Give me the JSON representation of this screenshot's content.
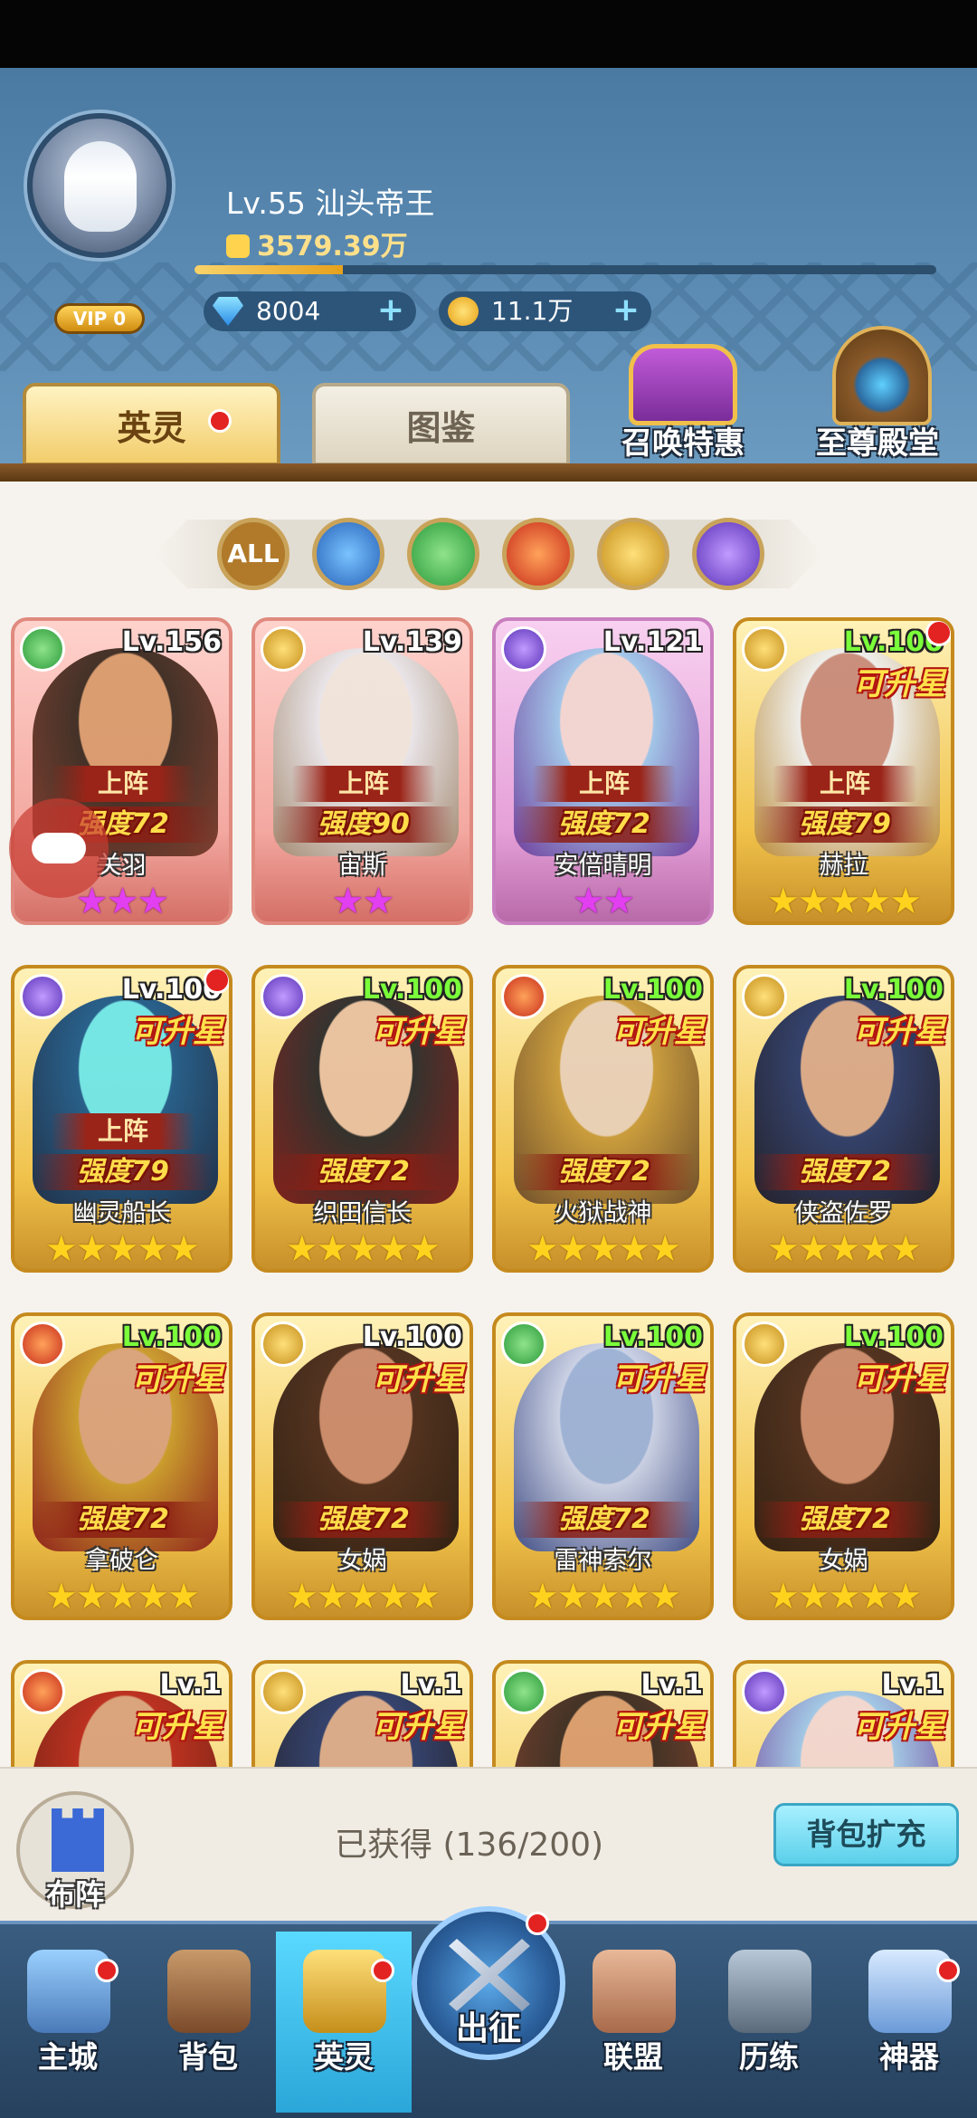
{
  "player": {
    "level_name": "Lv.55   汕头帝王",
    "power": "3579.39万",
    "vip": "VIP 0",
    "exp_progress": 0.2
  },
  "currencies": {
    "gems": "8004",
    "gold": "11.1万"
  },
  "tabs": {
    "heroes": "英灵",
    "gallery": "图鉴"
  },
  "shortcuts": {
    "summon_deal": "召唤特惠",
    "supreme_hall": "至尊殿堂"
  },
  "filters": {
    "all": "ALL"
  },
  "heroes": [
    {
      "level": "Lv.156",
      "level_green": false,
      "upgradable": "",
      "deployed": "上阵",
      "strength": "强度72",
      "name": "关羽",
      "stars": "★★★",
      "star_type": "pink",
      "element": "nature",
      "frame": "red",
      "skin": "#d89b6c",
      "tone": "#3a2a20",
      "tone2": "#7a3a2a"
    },
    {
      "level": "Lv.139",
      "level_green": false,
      "upgradable": "",
      "deployed": "上阵",
      "strength": "强度90",
      "name": "宙斯",
      "stars": "★★",
      "star_type": "pink",
      "element": "light",
      "frame": "red",
      "skin": "#f0e6dc",
      "tone": "#e8e6ea",
      "tone2": "#a08a70"
    },
    {
      "level": "Lv.121",
      "level_green": false,
      "upgradable": "",
      "deployed": "上阵",
      "strength": "强度72",
      "name": "安倍晴明",
      "stars": "★★",
      "star_type": "pink",
      "element": "dark",
      "frame": "purple",
      "skin": "#f2d6d0",
      "tone": "#9ec6e8",
      "tone2": "#6a3a9a"
    },
    {
      "level": "Lv.100",
      "level_green": true,
      "upgradable": "可升星",
      "deployed": "上阵",
      "strength": "强度79",
      "name": "赫拉",
      "stars": "★★★★★",
      "star_type": "gold",
      "element": "light",
      "frame": "gold",
      "skin": "#c88a7a",
      "tone": "#eeeeee",
      "tone2": "#b88a3a",
      "dot": true
    },
    {
      "level": "Lv.100",
      "level_green": false,
      "upgradable": "可升星",
      "deployed": "上阵",
      "strength": "强度79",
      "name": "幽灵船长",
      "stars": "★★★★★",
      "star_type": "gold",
      "element": "dark",
      "frame": "gold",
      "skin": "#6fe6e8",
      "tone": "#1e5a8a",
      "tone2": "#162a4a",
      "dot": true
    },
    {
      "level": "Lv.100",
      "level_green": true,
      "upgradable": "可升星",
      "deployed": "",
      "strength": "强度72",
      "name": "织田信长",
      "stars": "★★★★★",
      "star_type": "gold",
      "element": "dark",
      "frame": "gold",
      "skin": "#e8c0a0",
      "tone": "#2a2a2a",
      "tone2": "#7a1a1a"
    },
    {
      "level": "Lv.100",
      "level_green": true,
      "upgradable": "可升星",
      "deployed": "",
      "strength": "强度72",
      "name": "火狱战神",
      "stars": "★★★★★",
      "star_type": "gold",
      "element": "fire",
      "frame": "gold",
      "skin": "#e8d0b8",
      "tone": "#c89a3a",
      "tone2": "#6a4a2a"
    },
    {
      "level": "Lv.100",
      "level_green": true,
      "upgradable": "可升星",
      "deployed": "",
      "strength": "强度72",
      "name": "侠盗佐罗",
      "stars": "★★★★★",
      "star_type": "gold",
      "element": "light",
      "frame": "gold",
      "skin": "#d8a888",
      "tone": "#2a3a6a",
      "tone2": "#1a1a2a"
    },
    {
      "level": "Lv.100",
      "level_green": true,
      "upgradable": "可升星",
      "deployed": "",
      "strength": "强度72",
      "name": "拿破仑",
      "stars": "★★★★★",
      "star_type": "gold",
      "element": "fire",
      "frame": "gold",
      "skin": "#d8a07a",
      "tone": "#c89a2a",
      "tone2": "#8a1a1a"
    },
    {
      "level": "Lv.100",
      "level_green": false,
      "upgradable": "可升星",
      "deployed": "",
      "strength": "强度72",
      "name": "女娲",
      "stars": "★★★★★",
      "star_type": "gold",
      "element": "light",
      "frame": "gold",
      "skin": "#c8886a",
      "tone": "#4a2a1a",
      "tone2": "#2a1a10"
    },
    {
      "level": "Lv.100",
      "level_green": true,
      "upgradable": "可升星",
      "deployed": "",
      "strength": "强度72",
      "name": "雷神索尔",
      "stars": "★★★★★",
      "star_type": "gold",
      "element": "nature",
      "frame": "gold",
      "skin": "#9ab0d8",
      "tone": "#c8d0e8",
      "tone2": "#3a4a8a"
    },
    {
      "level": "Lv.100",
      "level_green": true,
      "upgradable": "可升星",
      "deployed": "",
      "strength": "强度72",
      "name": "女娲",
      "stars": "★★★★★",
      "star_type": "gold",
      "element": "light",
      "frame": "gold",
      "skin": "#c8886a",
      "tone": "#4a2a1a",
      "tone2": "#2a1a10"
    },
    {
      "level": "Lv.1",
      "level_green": false,
      "upgradable": "可升星",
      "deployed": "",
      "strength": "",
      "name": "",
      "stars": "",
      "star_type": "gold",
      "element": "fire",
      "frame": "gold",
      "skin": "#d8a07a",
      "tone": "#b8281a",
      "tone2": "#6a1a10"
    },
    {
      "level": "Lv.1",
      "level_green": false,
      "upgradable": "可升星",
      "deployed": "",
      "strength": "",
      "name": "",
      "stars": "",
      "star_type": "gold",
      "element": "light",
      "frame": "gold",
      "skin": "#d8a888",
      "tone": "#2a3a6a",
      "tone2": "#1a1a2a"
    },
    {
      "level": "Lv.1",
      "level_green": false,
      "upgradable": "可升星",
      "deployed": "",
      "strength": "",
      "name": "",
      "stars": "",
      "star_type": "gold",
      "element": "nature",
      "frame": "gold",
      "skin": "#d89b6c",
      "tone": "#3a2a20",
      "tone2": "#7a3a2a"
    },
    {
      "level": "Lv.1",
      "level_green": false,
      "upgradable": "可升星",
      "deployed": "",
      "strength": "",
      "name": "",
      "stars": "",
      "star_type": "gold",
      "element": "dark",
      "frame": "gold",
      "skin": "#f2d6d0",
      "tone": "#9ec6e8",
      "tone2": "#6a3a9a"
    }
  ],
  "footer": {
    "deploy": "布阵",
    "obtained": "已获得  (136/200)",
    "expand": "背包扩充"
  },
  "nav": {
    "city": "主城",
    "bag": "背包",
    "heroes": "英灵",
    "battle": "出征",
    "alliance": "联盟",
    "training": "历练",
    "artifact": "神器"
  }
}
